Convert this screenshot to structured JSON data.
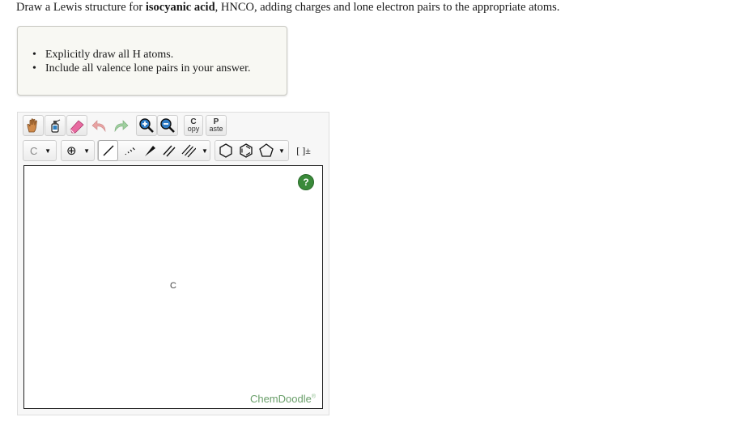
{
  "question": {
    "prefix": "Draw a Lewis structure for ",
    "compound": "isocyanic acid",
    "formula_sep": ", ",
    "formula": "HNCO",
    "suffix": ", adding charges and lone electron pairs to the appropriate atoms."
  },
  "hints": [
    "Explicitly draw all H atoms.",
    "Include all valence lone pairs in your answer."
  ],
  "toolbar": {
    "copy_top": "C",
    "copy_bottom": "opy",
    "paste_top": "P",
    "paste_bottom": "aste",
    "atom_label": "C",
    "charge_symbol": "⊕",
    "bracket_label": "[ ]±"
  },
  "canvas": {
    "atom_label": "C",
    "help_symbol": "?",
    "brand": "ChemDoodle",
    "brand_mark": "®"
  },
  "colors": {
    "help_green": "#3a8a3a",
    "brand_green": "#6a9f6a",
    "hint_bg": "#f8f8f3"
  }
}
